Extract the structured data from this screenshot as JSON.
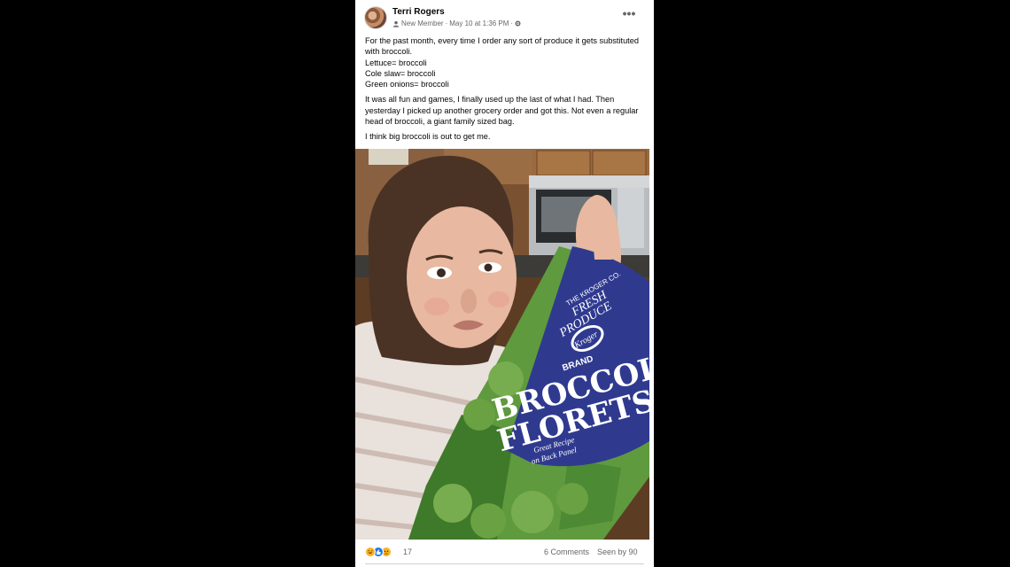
{
  "post": {
    "author": "Terri Rogers",
    "badge": "New Member",
    "separator1": "·",
    "timestamp": "May 10 at 1:36 PM",
    "separator2": "·",
    "more_label": "•••",
    "paragraph1": {
      "line1": "For the past month, every time I order any sort of produce it gets substituted with broccoli.",
      "line2": "Lettuce= broccoli",
      "line3": "Cole slaw= broccoli",
      "line4": "Green onions= broccoli"
    },
    "paragraph2": "It was all fun and games, I finally used up the last of what I had. Then yesterday I picked up another grocery order and got this. Not even a regular head of broccoli, a giant family sized bag.",
    "paragraph3": "I think big broccoli is out to get me.",
    "photo": {
      "bag_brand_line1": "THE KROGER CO.",
      "bag_brand_line2": "FRESH",
      "bag_brand_line3": "PRODUCE",
      "bag_logo": "Kroger",
      "bag_brand_word": "BRAND",
      "bag_title1": "BROCCOLI",
      "bag_title2": "FLORETS",
      "bag_sub1": "Great Recipe",
      "bag_sub2": "on Back Panel"
    },
    "footer": {
      "reaction_icons": [
        "haha-icon",
        "like-icon",
        "sad-icon"
      ],
      "reaction_count": "17",
      "comments": "6 Comments",
      "seen": "Seen by 90"
    },
    "colors": {
      "background": "#000000",
      "card": "#ffffff",
      "text": "#050505",
      "muted": "#65676b",
      "like": "#1877f2",
      "haha": "#f7b125"
    }
  }
}
